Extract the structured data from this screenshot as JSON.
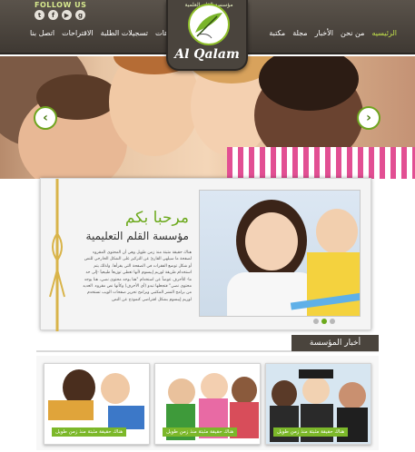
{
  "header": {
    "follow_label": "FOLLOW US",
    "social": [
      "twitter-icon",
      "facebook-icon",
      "youtube-icon",
      "google-plus-icon"
    ],
    "nav_right": [
      "الرئيسيه",
      "من نحن",
      "الأخبار",
      "مجلة",
      "مكتبة"
    ],
    "nav_left": [
      "فيديوهات",
      "تسجيلات الطلبة",
      "الاقتراحات",
      "اتصل بنا"
    ],
    "active_color": "#c3e34b"
  },
  "logo": {
    "arc_text": "مؤسسة القلم العلمية",
    "name": "Al Qalam"
  },
  "welcome": {
    "title": "مرحبا بكم",
    "subtitle": "مؤسسة القلم التعليمية",
    "body": "هناك حقيقة مثبتة منذ زمن طويل وهي أن المحتوى المقروء لصفحة ما سيلهي القارئ عن التركيز على الشكل الخارجي للنص أو شكل توضع الفقرات في الصفحة التي يقرأها. ولذلك يتم استخدام طريقة لوريم إيبسوم لأنها تعطي توزيعاَ طبيعياَ -إلى حد ما- للأحرف عوضاً عن استخدام \"هنا يوجد محتوى نصي، هنا يوجد محتوى نصي\" فتجعلها تبدو (أي الأحرف) وكأنها نص مقروء. العديد من برامح النشر المكتبي وبرامح تحرير صفحات الويب تستخدم لوريم إيبسوم بشكل افتراضي كنموذج عن النص",
    "accent": "#6ca91c"
  },
  "news": {
    "tab_label": "أخبار المؤسسة",
    "cards": [
      {
        "caption": "هناك حقيقة مثبتة منذ زمن طويل"
      },
      {
        "caption": "هناك حقيقة مثبتة منذ زمن طويل"
      },
      {
        "caption": "هناك حقيقة مثبتة منذ زمن طويل"
      }
    ]
  },
  "slider": {
    "dots": 3,
    "active_dot": 1
  }
}
